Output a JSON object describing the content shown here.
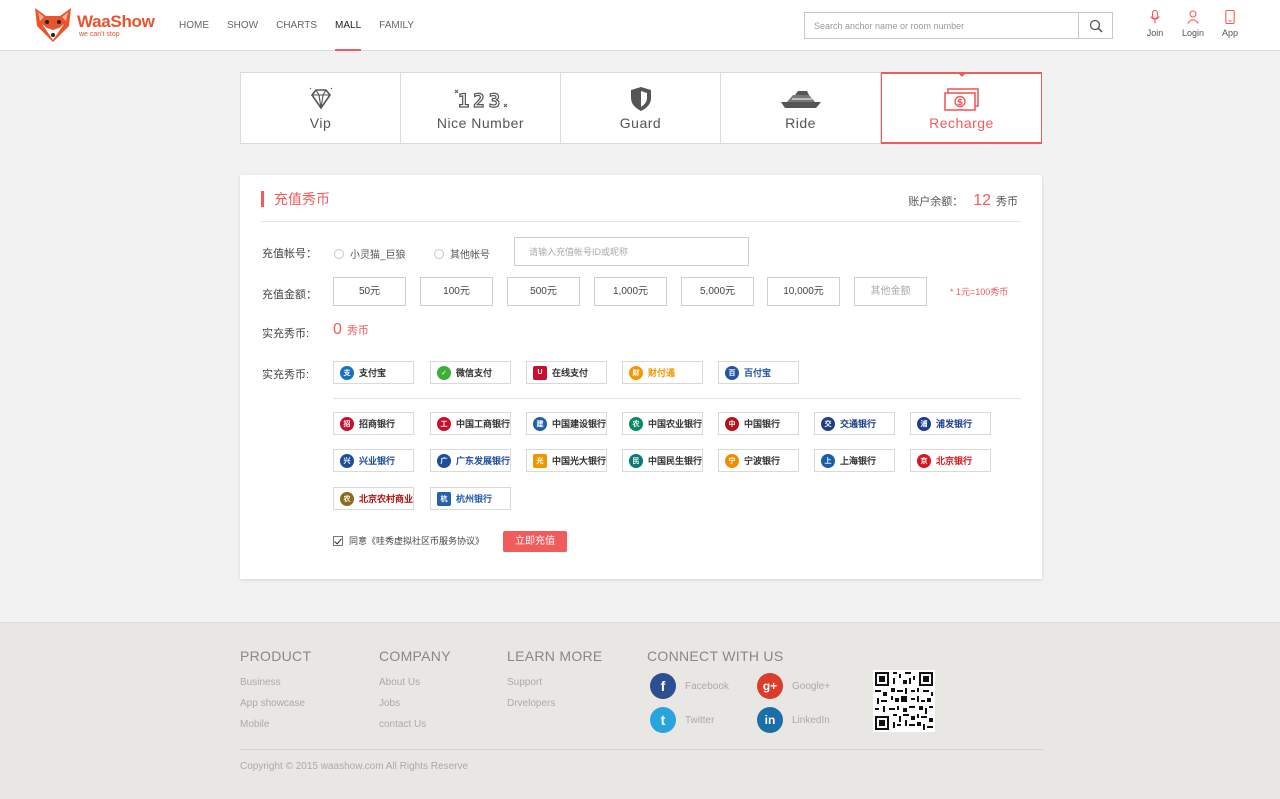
{
  "header": {
    "brand": "WaaShow",
    "slogan": "we can't stop",
    "nav": [
      {
        "label": "HOME",
        "active": false
      },
      {
        "label": "SHOW",
        "active": false
      },
      {
        "label": "CHARTS",
        "active": false
      },
      {
        "label": "MALL",
        "active": true
      },
      {
        "label": "FAMILY",
        "active": false
      }
    ],
    "search_placeholder": "Search anchor name or room number",
    "actions": {
      "join": "Join",
      "login": "Login",
      "app": "App"
    }
  },
  "categories": [
    {
      "label": "Vip",
      "icon": "diamond-icon",
      "active": false
    },
    {
      "label": "Nice Number",
      "icon": "number-123-icon",
      "active": false
    },
    {
      "label": "Guard",
      "icon": "shield-icon",
      "active": false
    },
    {
      "label": "Ride",
      "icon": "yacht-icon",
      "active": false
    },
    {
      "label": "Recharge",
      "icon": "banknote-icon",
      "active": true
    }
  ],
  "recharge": {
    "title": "充值秀币",
    "balance_label": "账户余额：",
    "balance_value": "12",
    "balance_unit": "秀币",
    "account_label": "充值帐号：",
    "account_options": [
      "小灵猫_巨狼",
      "其他帐号"
    ],
    "account_placeholder": "请输入充值帐号ID或昵称",
    "amount_label": "充值金额：",
    "amounts": [
      "50元",
      "100元",
      "500元",
      "1,000元",
      "5,000元",
      "10,000元"
    ],
    "other_amount": "其他金额",
    "rate_note": "* 1元=100秀币",
    "actual_label": "实充秀币:",
    "actual_value": "0",
    "actual_unit": "秀币",
    "pay_label": "实充秀币:",
    "agree_text": "同意《哇秀虚拟社区币服务协议》",
    "submit_label": "立即充值"
  },
  "payment_platforms": [
    {
      "name": "支付宝",
      "color": "#1a6fc4"
    },
    {
      "name": "微信支付",
      "color": "#3cb034"
    },
    {
      "name": "在线支付",
      "color": "#c8102e"
    },
    {
      "name": "财付通",
      "color": "#f39800"
    },
    {
      "name": "百付宝",
      "color": "#2156a5"
    }
  ],
  "banks": [
    {
      "name": "招商银行",
      "color": "#c8102e"
    },
    {
      "name": "中国工商银行",
      "color": "#c8102e"
    },
    {
      "name": "中国建设银行",
      "color": "#1f5fa8"
    },
    {
      "name": "中国农业银行",
      "color": "#0b8a6a"
    },
    {
      "name": "中国银行",
      "color": "#b5121b"
    },
    {
      "name": "交通银行",
      "color": "#1e3f8a"
    },
    {
      "name": "浦发银行",
      "color": "#1d3d8f"
    },
    {
      "name": "兴业银行",
      "color": "#1f4b9b"
    },
    {
      "name": "广东发展银行",
      "color": "#1f4b9b"
    },
    {
      "name": "中国光大银行",
      "color": "#f29600"
    },
    {
      "name": "中国民生银行",
      "color": "#0a7a72"
    },
    {
      "name": "宁波银行",
      "color": "#f08c00"
    },
    {
      "name": "上海银行",
      "color": "#1a5ea8"
    },
    {
      "name": "北京银行",
      "color": "#d7161f"
    },
    {
      "name": "北京农村商业银行",
      "color": "#8a6d1b"
    },
    {
      "name": "杭州银行",
      "color": "#2561ad"
    }
  ],
  "footer": {
    "product": {
      "title": "PRODUCT",
      "links": [
        "Business",
        "App showcase",
        "Mobile"
      ]
    },
    "company": {
      "title": "COMPANY",
      "links": [
        "About Us",
        "Jobs",
        "contact Us"
      ]
    },
    "learn": {
      "title": "LEARN MORE",
      "links": [
        "Support",
        "Drvelopers"
      ]
    },
    "connect": {
      "title": "CONNECT WITH US",
      "items": [
        {
          "name": "Facebook",
          "color": "#2b4f91",
          "glyph": "f"
        },
        {
          "name": "Google+",
          "color": "#dc3d2a",
          "glyph": "g+"
        },
        {
          "name": "Twitter",
          "color": "#2aa4de",
          "glyph": "t"
        },
        {
          "name": "LinkedIn",
          "color": "#1c6ea7",
          "glyph": "in"
        }
      ]
    },
    "copyright": "Copyright © 2015 waashow.com All Rights Reserve"
  }
}
